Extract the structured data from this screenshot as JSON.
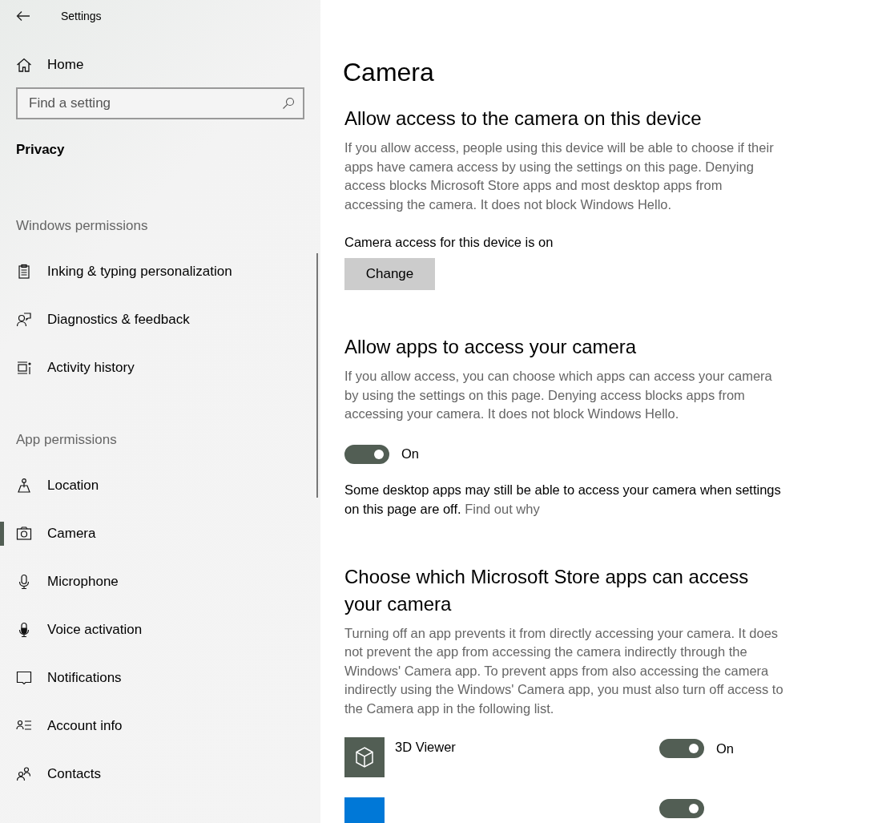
{
  "window": {
    "title": "Settings"
  },
  "sidebar": {
    "home": "Home",
    "search": {
      "placeholder": "Find a setting"
    },
    "category": "Privacy",
    "groups": [
      {
        "header": "Windows permissions",
        "items": [
          {
            "label": "Inking & typing personalization",
            "kind": "clipboard",
            "selected": false
          },
          {
            "label": "Diagnostics & feedback",
            "kind": "feedback",
            "selected": false
          },
          {
            "label": "Activity history",
            "kind": "timeline",
            "selected": false
          }
        ]
      },
      {
        "header": "App permissions",
        "items": [
          {
            "label": "Location",
            "kind": "location",
            "selected": false
          },
          {
            "label": "Camera",
            "kind": "camera",
            "selected": true
          },
          {
            "label": "Microphone",
            "kind": "mic",
            "selected": false
          },
          {
            "label": "Voice activation",
            "kind": "micfilled",
            "selected": false
          },
          {
            "label": "Notifications",
            "kind": "notification",
            "selected": false
          },
          {
            "label": "Account info",
            "kind": "account",
            "selected": false
          },
          {
            "label": "Contacts",
            "kind": "contacts",
            "selected": false
          }
        ]
      }
    ]
  },
  "page": {
    "title": "Camera",
    "device_section": {
      "heading": "Allow access to the camera on this device",
      "description": "If you allow access, people using this device will be able to choose if their apps have camera access by using the settings on this page. Denying access blocks Microsoft Store apps and most desktop apps from accessing the camera. It does not block Windows Hello.",
      "status": "Camera access for this device is on",
      "button": "Change"
    },
    "apps_section": {
      "heading": "Allow apps to access your camera",
      "description": "If you allow access, you can choose which apps can access your camera by using the settings on this page. Denying access blocks apps from accessing your camera. It does not block Windows Hello.",
      "toggle": {
        "on": true,
        "label": "On"
      },
      "note": {
        "text": "Some desktop apps may still be able to access your camera when settings on this page are off.",
        "link": "Find out why"
      }
    },
    "store_section": {
      "heading": "Choose which Microsoft Store apps can access your camera",
      "description": "Turning off an app prevents it from directly accessing your camera. It does not prevent the app from accessing the camera indirectly through the Windows' Camera app. To prevent apps from also accessing the camera indirectly using the Windows' Camera app, you must also turn off access to the Camera app in the following list.",
      "apps": [
        {
          "name": "3D Viewer",
          "color": "#525e54",
          "kind": "cube",
          "on": true,
          "state_label": "On"
        },
        {
          "color": "#0078d7",
          "on": true
        }
      ]
    }
  }
}
